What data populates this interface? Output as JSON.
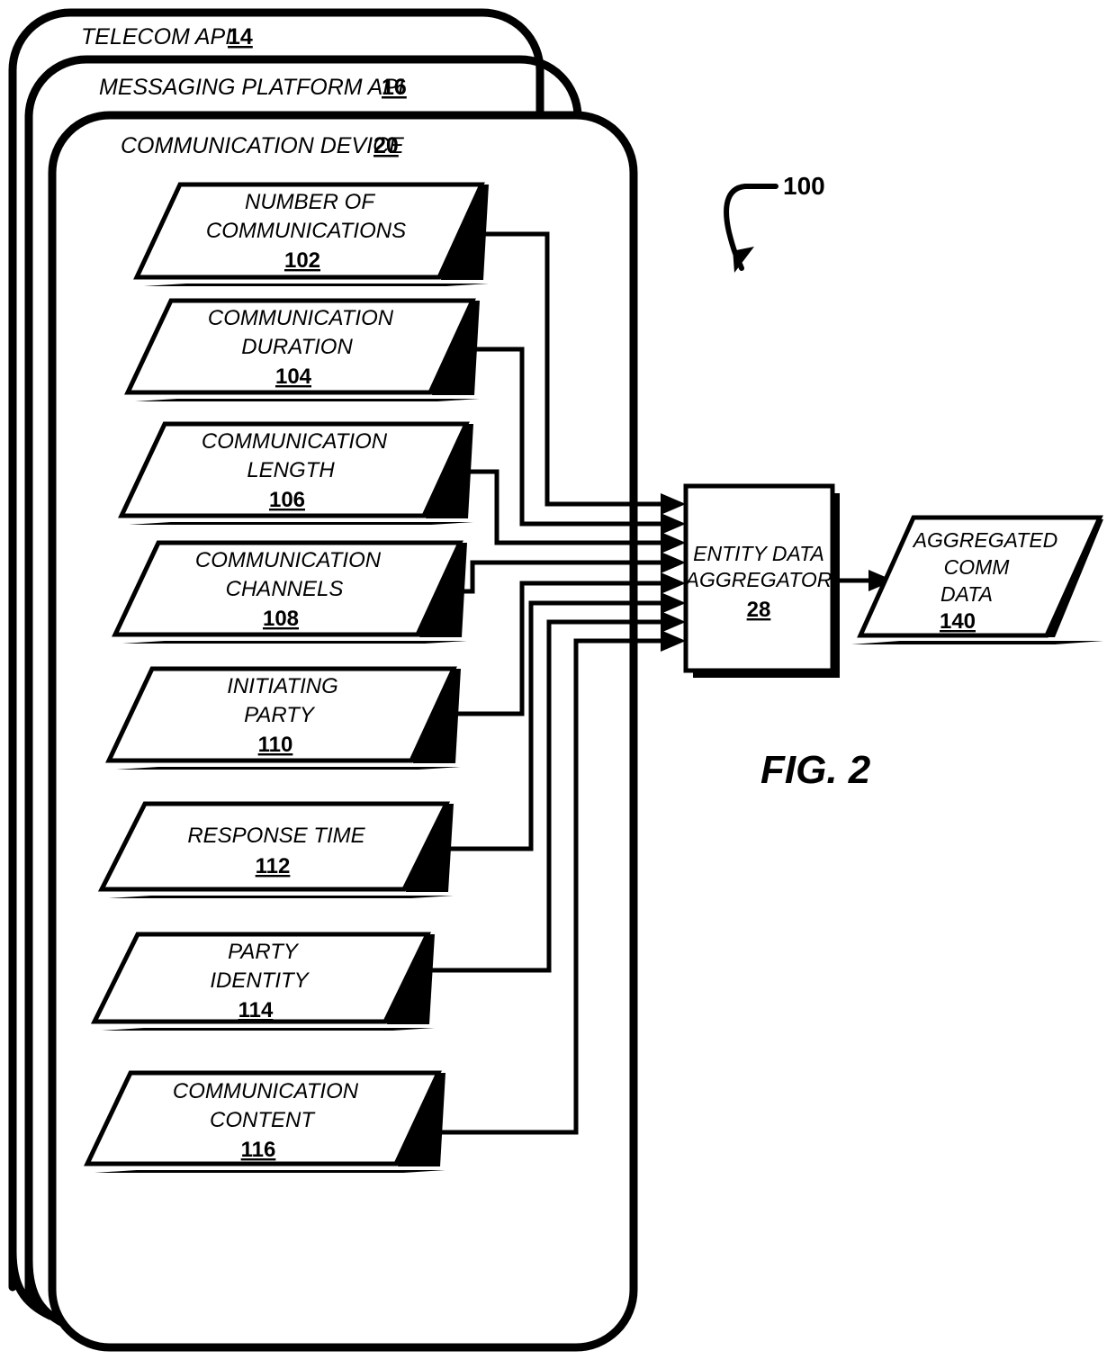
{
  "figure": {
    "label": "FIG. 2",
    "system_ref": "100"
  },
  "layers": [
    {
      "name": "telecom-api",
      "title": "TELECOM API",
      "ref": "14"
    },
    {
      "name": "messaging-platform-api",
      "title": "MESSAGING PLATFORM API",
      "ref": "16"
    },
    {
      "name": "communication-device",
      "title": "COMMUNICATION DEVICE",
      "ref": "20"
    }
  ],
  "data_nodes": [
    {
      "name": "number-of-communications",
      "lines": [
        "NUMBER OF",
        "COMMUNICATIONS"
      ],
      "ref": "102"
    },
    {
      "name": "communication-duration",
      "lines": [
        "COMMUNICATION",
        "DURATION"
      ],
      "ref": "104"
    },
    {
      "name": "communication-length",
      "lines": [
        "COMMUNICATION",
        "LENGTH"
      ],
      "ref": "106"
    },
    {
      "name": "communication-channels",
      "lines": [
        "COMMUNICATION",
        "CHANNELS"
      ],
      "ref": "108"
    },
    {
      "name": "initiating-party",
      "lines": [
        "INITIATING",
        "PARTY"
      ],
      "ref": "110"
    },
    {
      "name": "response-time",
      "lines": [
        "RESPONSE TIME"
      ],
      "ref": "112"
    },
    {
      "name": "party-identity",
      "lines": [
        "PARTY",
        "IDENTITY"
      ],
      "ref": "114"
    },
    {
      "name": "communication-content",
      "lines": [
        "COMMUNICATION",
        "CONTENT"
      ],
      "ref": "116"
    }
  ],
  "aggregator": {
    "name": "entity-data-aggregator",
    "lines": [
      "ENTITY DATA",
      "AGGREGATOR"
    ],
    "ref": "28"
  },
  "output": {
    "name": "aggregated-comm-data",
    "lines": [
      "AGGREGATED",
      "COMM",
      "DATA"
    ],
    "ref": "140"
  },
  "colors": {
    "stroke": "#000000",
    "background": "#ffffff"
  }
}
